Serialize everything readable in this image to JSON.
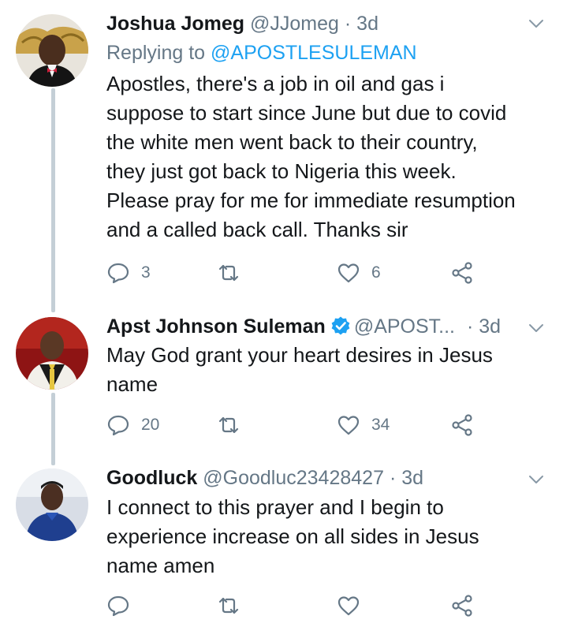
{
  "tweets": [
    {
      "name": "Joshua Jomeg",
      "handle": "@JJomeg",
      "dot": "·",
      "time": "3d",
      "replying_label": "Replying to",
      "replying_to": "@APOSTLESULEMAN",
      "text_lines": [
        "Apostles, there's a job in oil and gas i",
        "suppose to start since June but due to covid",
        "the white men went back to their country,",
        "they just got back to Nigeria this week.",
        "Please pray for me for immediate resumption",
        "and a called back call. Thanks sir"
      ],
      "replies": "3",
      "retweets": "",
      "likes": "6"
    },
    {
      "name": "Apst Johnson Suleman",
      "verified": true,
      "handle": "@APOST...",
      "dot": "·",
      "time": "3d",
      "text_lines": [
        "May God grant your heart desires in Jesus",
        "name"
      ],
      "replies": "20",
      "retweets": "",
      "likes": "34"
    },
    {
      "name": "Goodluck",
      "handle": "@Goodluc23428427",
      "dot": "·",
      "time": "3d",
      "text_lines": [
        "I connect to this prayer and I begin to",
        "experience increase on all sides in Jesus",
        "name amen"
      ],
      "replies": "",
      "retweets": "",
      "likes": ""
    }
  ],
  "colors": {
    "text": "#14171a",
    "muted": "#657786",
    "link": "#1da1f2",
    "thread_line": "#c4cfd6"
  },
  "icons": [
    "reply-icon",
    "retweet-icon",
    "like-icon",
    "share-icon",
    "chevron-down-icon",
    "verified-badge-icon"
  ]
}
